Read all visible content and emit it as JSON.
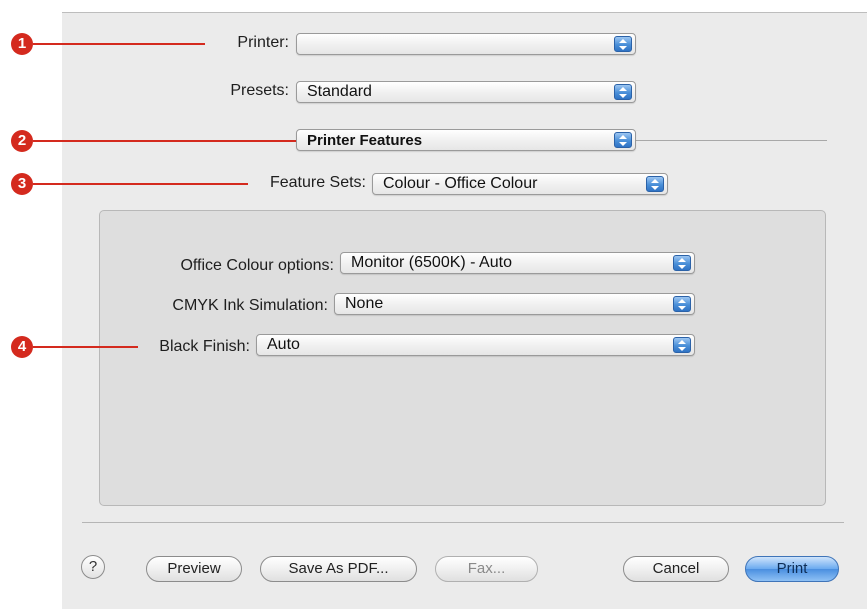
{
  "callouts": [
    "1",
    "2",
    "3",
    "4"
  ],
  "printer": {
    "label": "Printer:",
    "value": ""
  },
  "presets": {
    "label": "Presets:",
    "value": "Standard"
  },
  "pane": {
    "value": "Printer Features"
  },
  "feature_sets": {
    "label": "Feature Sets:",
    "value": "Colour - Office Colour"
  },
  "options": {
    "office_colour": {
      "label": "Office Colour options:",
      "value": "Monitor (6500K) - Auto"
    },
    "cmyk": {
      "label": "CMYK Ink Simulation:",
      "value": "None"
    },
    "black_finish": {
      "label": "Black Finish:",
      "value": "Auto"
    }
  },
  "buttons": {
    "help": "?",
    "preview": "Preview",
    "save_pdf": "Save As PDF...",
    "fax": "Fax...",
    "cancel": "Cancel",
    "print": "Print"
  },
  "colors": {
    "callout": "#d42a1e",
    "accent": "#4a8fd8"
  },
  "icons": {
    "popup_arrows": "up-down-arrows-icon"
  }
}
